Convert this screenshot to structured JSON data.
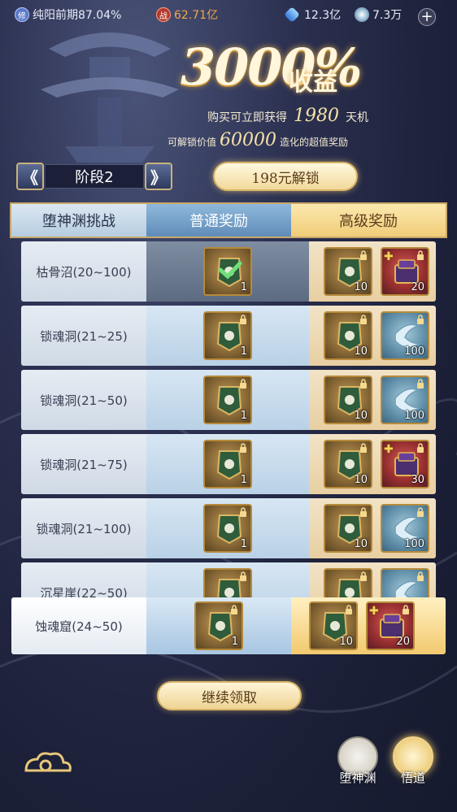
{
  "topbar": {
    "cultivation": "纯阳前期87.04%",
    "cultivation_icon": "cultivation-icon",
    "power_badge": "战",
    "power": "62.71亿",
    "gems": "12.3亿",
    "coins": "7.3万"
  },
  "headline": {
    "big": "3000%",
    "suffix": "收益",
    "line1_pre": "购买可立即获得",
    "line1_num": "1980",
    "line1_post": "天机",
    "line2_pre": "可解锁价值",
    "line2_num": "60000",
    "line2_post": "造化的超值奖励"
  },
  "stage": {
    "prev": "《",
    "label": "阶段2",
    "next": "》"
  },
  "unlock_button": "198元解锁",
  "table_header": {
    "challenge": "堕神渊挑战",
    "normal": "普通奖励",
    "premium": "高级奖励"
  },
  "rows": [
    {
      "name": "枯骨沼(20~100)",
      "normal": {
        "qty": "1",
        "claimed": true
      },
      "premium": [
        {
          "qty": "10",
          "kind": "green"
        },
        {
          "qty": "20",
          "kind": "purple"
        }
      ]
    },
    {
      "name": "锁魂洞(21~25)",
      "normal": {
        "qty": "1",
        "claimed": false
      },
      "premium": [
        {
          "qty": "10",
          "kind": "green"
        },
        {
          "qty": "100",
          "kind": "blue"
        }
      ]
    },
    {
      "name": "锁魂洞(21~50)",
      "normal": {
        "qty": "1",
        "claimed": false
      },
      "premium": [
        {
          "qty": "10",
          "kind": "green"
        },
        {
          "qty": "100",
          "kind": "blue"
        }
      ]
    },
    {
      "name": "锁魂洞(21~75)",
      "normal": {
        "qty": "1",
        "claimed": false
      },
      "premium": [
        {
          "qty": "10",
          "kind": "green"
        },
        {
          "qty": "30",
          "kind": "purple"
        }
      ]
    },
    {
      "name": "锁魂洞(21~100)",
      "normal": {
        "qty": "1",
        "claimed": false
      },
      "premium": [
        {
          "qty": "10",
          "kind": "green"
        },
        {
          "qty": "100",
          "kind": "blue"
        }
      ]
    },
    {
      "name": "沉星崖(22~50)",
      "normal": {
        "qty": "",
        "claimed": false
      },
      "premium": [
        {
          "qty": "",
          "kind": "green"
        },
        {
          "qty": "",
          "kind": "blue"
        }
      ]
    },
    {
      "name": "蚀魂窟(24~50)",
      "normal": {
        "qty": "1",
        "claimed": false
      },
      "premium": [
        {
          "qty": "10",
          "kind": "green"
        },
        {
          "qty": "20",
          "kind": "purple"
        }
      ]
    }
  ],
  "continue_button": "继续领取",
  "bottom_nav": {
    "abyss": "堕神渊",
    "enlighten": "悟道"
  },
  "colors": {
    "accent_gold": "#f1cd79",
    "normal_blue": "#5f8cb8",
    "power_orange": "#f1a64a"
  }
}
